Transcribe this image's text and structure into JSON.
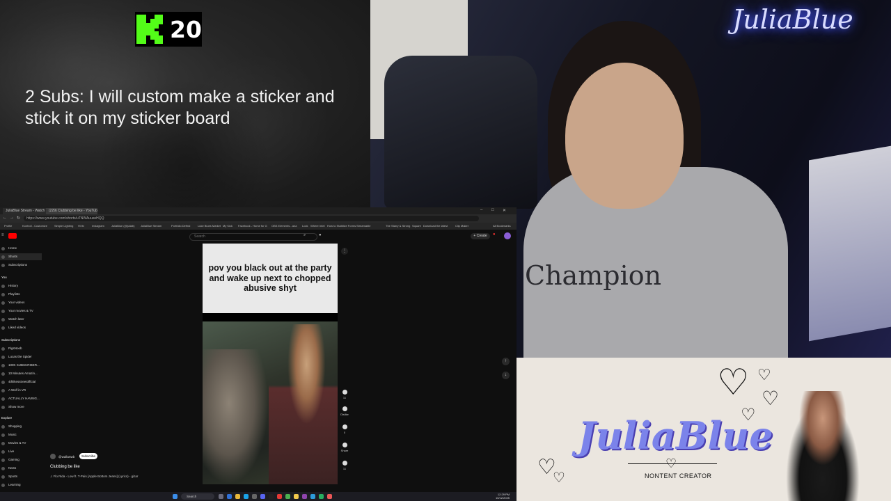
{
  "overlay": {
    "kick_count": "20",
    "goal_text": "2 Subs: I will custom make a sticker and stick it on my sticker board",
    "kick_color": "#53fc18"
  },
  "webcam": {
    "neon_sign": "JuliaBlue",
    "hoodie_logo": "Champion"
  },
  "browser": {
    "tabs": [
      "JuliaBlue Stream - Watch Live",
      "(229) Clubbing be like - YouTube"
    ],
    "url": "https://www.youtube.com/shorts/uTNWAuuavHQQ",
    "bookmarks": [
      "Profile",
      "Kontroll - Customize",
      "Simple Lighting",
      "Hi ttv",
      "Instagram",
      "JuliaBlue (@juliab)",
      "JuliaBlue Stream",
      "Portfolio Defind",
      "Luke Blues Market",
      "My Kick",
      "Facebook - Home for G",
      "OBS Elements - ana",
      "Lock",
      "Where Intel",
      "How to Stabilize Forms",
      "Streamable",
      "The Starry & Strong",
      "Square",
      "Download the latest",
      "Clip Maker",
      "All Bookmarks"
    ],
    "search_placeholder": "Search",
    "create_label": "Create",
    "sidebar": {
      "main": [
        "Home",
        "Shorts",
        "Subscriptions"
      ],
      "you_header": "You",
      "you": [
        "History",
        "Playlists",
        "Your videos",
        "Your movies & TV",
        "Watch later",
        "Liked videos"
      ],
      "subs_header": "Subscriptions",
      "subs": [
        "PigsNoob",
        "Lucas the Spider",
        "100K SUBSCRIBER...",
        "10 Minutes Amazin...",
        "4thlikesstreetofficial",
        "A Wolf in VR",
        "ACTUALLY HAVING...",
        "Show more"
      ],
      "explore_header": "Explore",
      "explore": [
        "Shopping",
        "Music",
        "Movies & TV",
        "Live",
        "Gaming",
        "News",
        "Sports",
        "Learning"
      ]
    },
    "short": {
      "caption": "pov you black out at the party and wake up next to chopped abusive shyt",
      "channel": "@wallartwb",
      "subscribe": "Subscribe",
      "title": "Clubbing be like",
      "music": "♫ Flo Rida - Low ft. T-Pain [Apple Bottom Jeans] (Lyrics) - gizar",
      "actions": [
        "11",
        "Dislike",
        "0",
        "Share",
        "11"
      ]
    },
    "taskbar": {
      "search": "Search",
      "time": "12:29 PM",
      "date": "10/12/2025"
    }
  },
  "banner": {
    "title": "JuliaBlue",
    "subtitle": "NONTENT CREATOR",
    "accent": "#7b83ea"
  }
}
